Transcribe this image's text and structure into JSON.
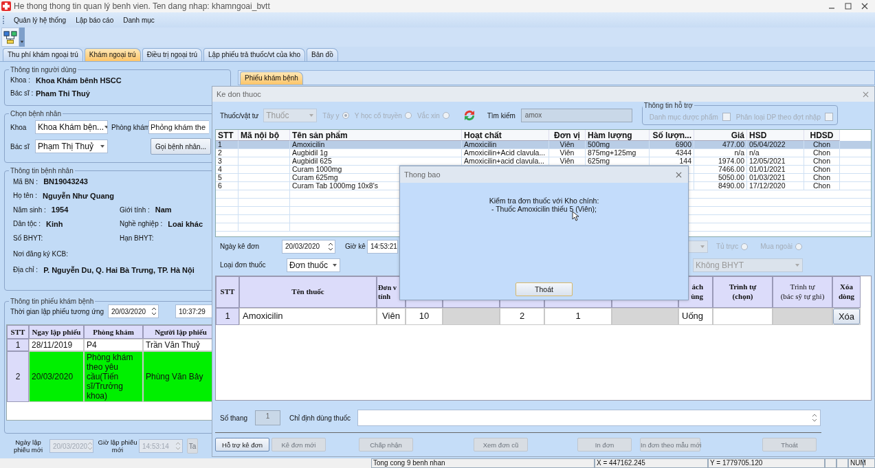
{
  "window": {
    "title": "He thong thong tin quan lý benh vien. Ten dang nhap: khamngoai_bvtt"
  },
  "menu": [
    "Quản lý hệ thống",
    "Lập báo cáo",
    "Danh mục"
  ],
  "tabs": [
    {
      "label": "Thu phí khám ngoại trú",
      "selected": false
    },
    {
      "label": "Khám ngoại trú",
      "selected": true
    },
    {
      "label": "Điều trị ngoại trú",
      "selected": false
    },
    {
      "label": "Lập phiếu trả thuốc/vt của kho",
      "selected": false
    },
    {
      "label": "Bản đồ",
      "selected": false
    }
  ],
  "user_info": {
    "title": "Thông tin người dùng",
    "fields": [
      {
        "label": "Khoa :",
        "value": "Khoa Khám bênh  HSCC"
      },
      {
        "label": "Bác sĩ :",
        "value": "Pham Thi Thuỷ"
      }
    ]
  },
  "choose_patient": {
    "title": "Chọn bệnh nhân",
    "department_label": "Khoa",
    "department": "Khoa Khám bện...",
    "room_label": "Phòng khám",
    "room": "Phỏng khám the",
    "doctor_label": "Bác sĩ",
    "doctor": "Phạm Thị Thuỷ",
    "call_button": "Gọi bệnh nhân..."
  },
  "patient_info": {
    "title": "Thông tin bệnh nhân",
    "rows": [
      [
        {
          "label": "Mã BN :",
          "value": "BN19043243"
        }
      ],
      [
        {
          "label": "Họ tên :",
          "value": "Nguyễn Như Quang"
        }
      ],
      [
        {
          "label": "Năm sinh :",
          "value": "1954"
        },
        {
          "label": "Giới tính :",
          "value": "Nam"
        }
      ],
      [
        {
          "label": "Dân tộc :",
          "value": "Kinh"
        },
        {
          "label": "Nghề nghiệp :",
          "value": "Loai khác"
        }
      ],
      [
        {
          "label": "Số BHYT:"
        },
        {
          "label": "Hạn BHYT:"
        }
      ],
      [
        {
          "label": "Nơi đăng ký KCB:"
        }
      ],
      [
        {
          "label": "Địa chỉ :",
          "value": "P. Nguyễn Du, Q. Hai Bà Trưng, TP. Hà Nội"
        }
      ]
    ]
  },
  "visit_info": {
    "title": "Thông tin phiếu khám bệnh",
    "time_label": "Thời gian lập phiếu tương ứng",
    "date": "20/03/2020",
    "time": "10:37:29",
    "table": {
      "columns": [
        "STT",
        "Ngay lập phiếu",
        "Phòng khám",
        "Người lập phiếu"
      ],
      "rows": [
        {
          "cells": [
            "1",
            "28/11/2019",
            "P4",
            "Trần Văn Thuỷ"
          ],
          "selected": false
        },
        {
          "cells": [
            "2",
            "20/03/2020",
            "Phòng khám theo yêu cầu(Tiến sĩ/Trưởng khoa)",
            "Phùng Văn Bảy"
          ],
          "selected": true
        }
      ]
    },
    "new_date_label": "Ngày lập phiếu mới",
    "new_date": "20/03/2020",
    "new_time_label": "Giờ lập phiếu mới",
    "new_time": "14:53:14",
    "cut_button": "Ta"
  },
  "right_tab": {
    "label": "Phiếu khám bệnh",
    "selected": true
  },
  "prescription_dialog": {
    "title": "Ke don thuoc",
    "type_label": "Thuốc/vật tư",
    "type": "Thuốc",
    "medicine_kinds": [
      {
        "label": "Tây y",
        "selected": true
      },
      {
        "label": "Y học cổ truyền",
        "selected": false
      },
      {
        "label": "Vắc xin",
        "selected": false
      }
    ],
    "search_label": "Tìm kiếm",
    "search": "amox",
    "support": {
      "title": "Thông tin hỗ trợ",
      "options": [
        {
          "label": "Danh mục dược phẩm",
          "checked": false
        },
        {
          "label": "Phân loại DP theo đợt nhập",
          "checked": false
        }
      ]
    },
    "products": {
      "columns": [
        "STT",
        "Mã nội bộ",
        "Tên sản phẩm",
        "Hoạt chất",
        "Đơn vị",
        "Hàm lượng",
        "Số lượn...",
        "Giá",
        "HSD",
        "HDSD"
      ],
      "rows": [
        {
          "stt": "1",
          "name": "Amoxicilin",
          "ingredient": "Amoxicilin",
          "unit": "Viên",
          "strength": "500mg",
          "quantity": "6900",
          "price": "477.00",
          "expiry": "05/04/2022",
          "usage": "Chon",
          "selected": true
        },
        {
          "stt": "2",
          "name": "Augbidil 1g",
          "ingredient": "Amoxicilin+Acid clavula...",
          "unit": "Viên",
          "strength": "875mg+125mg",
          "quantity": "4344",
          "price": "n/a",
          "expiry": "n/a",
          "usage": "Chon",
          "selected": false
        },
        {
          "stt": "3",
          "name": "Augbidil 625",
          "ingredient": "Amoxicilin+acid clavula...",
          "unit": "Viên",
          "strength": "625mg",
          "quantity": "144",
          "price": "1974.00",
          "expiry": "12/05/2021",
          "usage": "Chon",
          "selected": false
        },
        {
          "stt": "4",
          "name": "Curam 1000mg",
          "price": "7466.00",
          "expiry": "01/01/2021",
          "usage": "Chon",
          "selected": false
        },
        {
          "stt": "5",
          "name": "Curam 625mg",
          "price": "5050.00",
          "expiry": "01/03/2021",
          "usage": "Chon",
          "selected": false
        },
        {
          "stt": "6",
          "name": "Curam Tab 1000mg 10x8's",
          "price": "8490.00",
          "expiry": "17/12/2020",
          "usage": "Chon",
          "selected": false
        }
      ]
    },
    "date_label": "Ngày kê đơn",
    "date": "20/03/2020",
    "time_label": "Giờ kê",
    "time": "14:53:21",
    "on_duty_label": "Tủ trực",
    "on_duty": false,
    "outside_label": "Mua ngoài",
    "outside": false,
    "prescription_type_label": "Loại đơn thuốc",
    "prescription_type": "Đơn thuốc",
    "insurance": "Không BHYT",
    "grid": {
      "columns": [
        {
          "kind": "label",
          "lines": [
            "STT"
          ]
        },
        {
          "kind": "label",
          "lines": [
            "Tên thuốc"
          ]
        },
        {
          "kind": "label",
          "lines": [
            "Đơn v",
            "tính"
          ]
        },
        {
          "kind": "covered"
        },
        {
          "kind": "covered"
        },
        {
          "kind": "covered"
        },
        {
          "kind": "covered"
        },
        {
          "kind": "covered"
        },
        {
          "kind": "label",
          "lines": [
            "ách",
            "ùng"
          ]
        },
        {
          "kind": "label",
          "lines": [
            "Trình tự",
            "(chọn)"
          ]
        },
        {
          "kind": "label",
          "lines": [
            "Trình tự",
            "(bác sỹ tự ghi)"
          ]
        },
        {
          "kind": "label",
          "lines": [
            "Xóa",
            "dòng"
          ]
        }
      ],
      "rows": [
        {
          "cells": [
            {
              "kind": "index",
              "text": "1"
            },
            {
              "kind": "text",
              "text": "Amoxicilin"
            },
            {
              "kind": "center",
              "text": "Viên"
            },
            {
              "kind": "center",
              "text": "10"
            },
            {
              "kind": "readonly"
            },
            {
              "kind": "center",
              "text": "2"
            },
            {
              "kind": "center",
              "text": "1"
            },
            {
              "kind": "readonly"
            },
            {
              "kind": "text",
              "text": "Uống"
            },
            {
              "kind": "text"
            },
            {
              "kind": "readonly"
            },
            {
              "kind": "button",
              "text": "Xóa"
            }
          ]
        }
      ]
    },
    "doses_label": "Số thang",
    "doses": "1",
    "instructions_label": "Chỉ định dùng thuốc",
    "buttons": [
      {
        "label": "Hỗ trợ kê đơn",
        "disabled": false
      },
      {
        "label": "Kê đơn mới",
        "disabled": true
      },
      {
        "label": "Chấp nhận",
        "disabled": true
      },
      {
        "label": "Xem đơn cũ",
        "disabled": true
      },
      {
        "label": "In đơn",
        "disabled": true
      },
      {
        "label": "In đơn theo mẫu mới",
        "disabled": true
      },
      {
        "label": "Thoát",
        "disabled": true
      }
    ]
  },
  "notice_dialog": {
    "title": "Thong bao",
    "message_lines": [
      "Kiểm tra đơn thuốc với Kho chính:",
      "- Thuốc Amoxicilin thiếu 5 (Viên);"
    ],
    "button": "Thoát"
  },
  "status_bar": {
    "patients": "Tong cong 9 benh nhan",
    "x": "X = 447162.245",
    "y": "Y = 1779705.120",
    "num": "NUM"
  }
}
